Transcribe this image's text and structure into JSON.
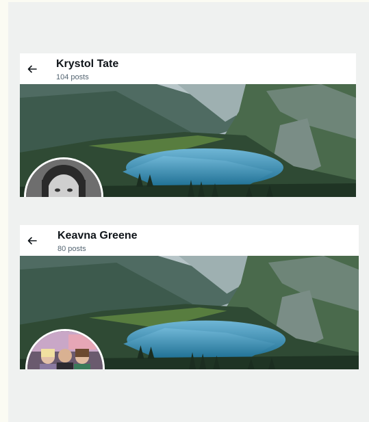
{
  "profiles": [
    {
      "name": "Krystol Tate",
      "posts": "104 posts"
    },
    {
      "name": "Keavna Greene",
      "posts": "80 posts"
    }
  ],
  "icons": {
    "back": "arrow-left-icon"
  }
}
